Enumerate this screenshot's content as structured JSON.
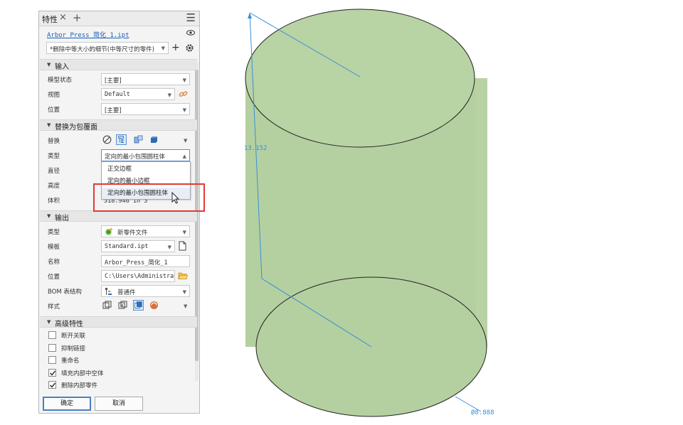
{
  "panel": {
    "tab_title": "特性",
    "tab_close": "×",
    "tab_add": "+",
    "tab_menu": "☰",
    "filename": "Arbor_Press_简化_1.ipt",
    "preset": "*删除中等大小的细节(中等尺寸的零件)",
    "add_symbol": "+"
  },
  "input_section": {
    "title": "输入",
    "rows": [
      {
        "label": "模型状态",
        "value": "[主要]"
      },
      {
        "label": "视图",
        "value": "Default"
      },
      {
        "label": "位置",
        "value": "[主要]"
      }
    ]
  },
  "envelope_section": {
    "title": "替换为包覆面",
    "replace_label": "替换",
    "type_label": "类型",
    "type_value": "定向的最小包围圆柱体",
    "diameter_label": "直径",
    "height_label": "高度",
    "volume_label": "体积",
    "volume_value": "518.946 in^3",
    "dropdown_options": [
      "正交边框",
      "定向的最小边框",
      "定向的最小包围圆柱体"
    ]
  },
  "output_section": {
    "title": "输出",
    "rows": [
      {
        "label": "类型",
        "value": "新零件文件"
      },
      {
        "label": "模板",
        "value": "Standard.ipt"
      },
      {
        "label": "名称",
        "value": "Arbor_Press_简化_1"
      },
      {
        "label": "位置",
        "value": "C:\\Users\\Administrator\\"
      },
      {
        "label": "BOM 表结构",
        "value": "普通件"
      },
      {
        "label": "样式",
        "value": ""
      }
    ]
  },
  "advanced_section": {
    "title": "高级特性",
    "checkboxes": [
      {
        "label": "断开关联",
        "checked": false
      },
      {
        "label": "抑制链接",
        "checked": false
      },
      {
        "label": "重命名",
        "checked": false
      },
      {
        "label": "填充内部中空体",
        "checked": true
      },
      {
        "label": "删除内部零件",
        "checked": true
      }
    ]
  },
  "buttons": {
    "ok": "确定",
    "cancel": "取消"
  },
  "viewport": {
    "dim_height": "13.152",
    "dim_diameter": "Ø8.888",
    "cylinder_color": "#b5d0a0"
  },
  "colors": {
    "accent": "#1a5fb4",
    "highlight": "#e53935",
    "dimension": "#3a8fd8"
  }
}
